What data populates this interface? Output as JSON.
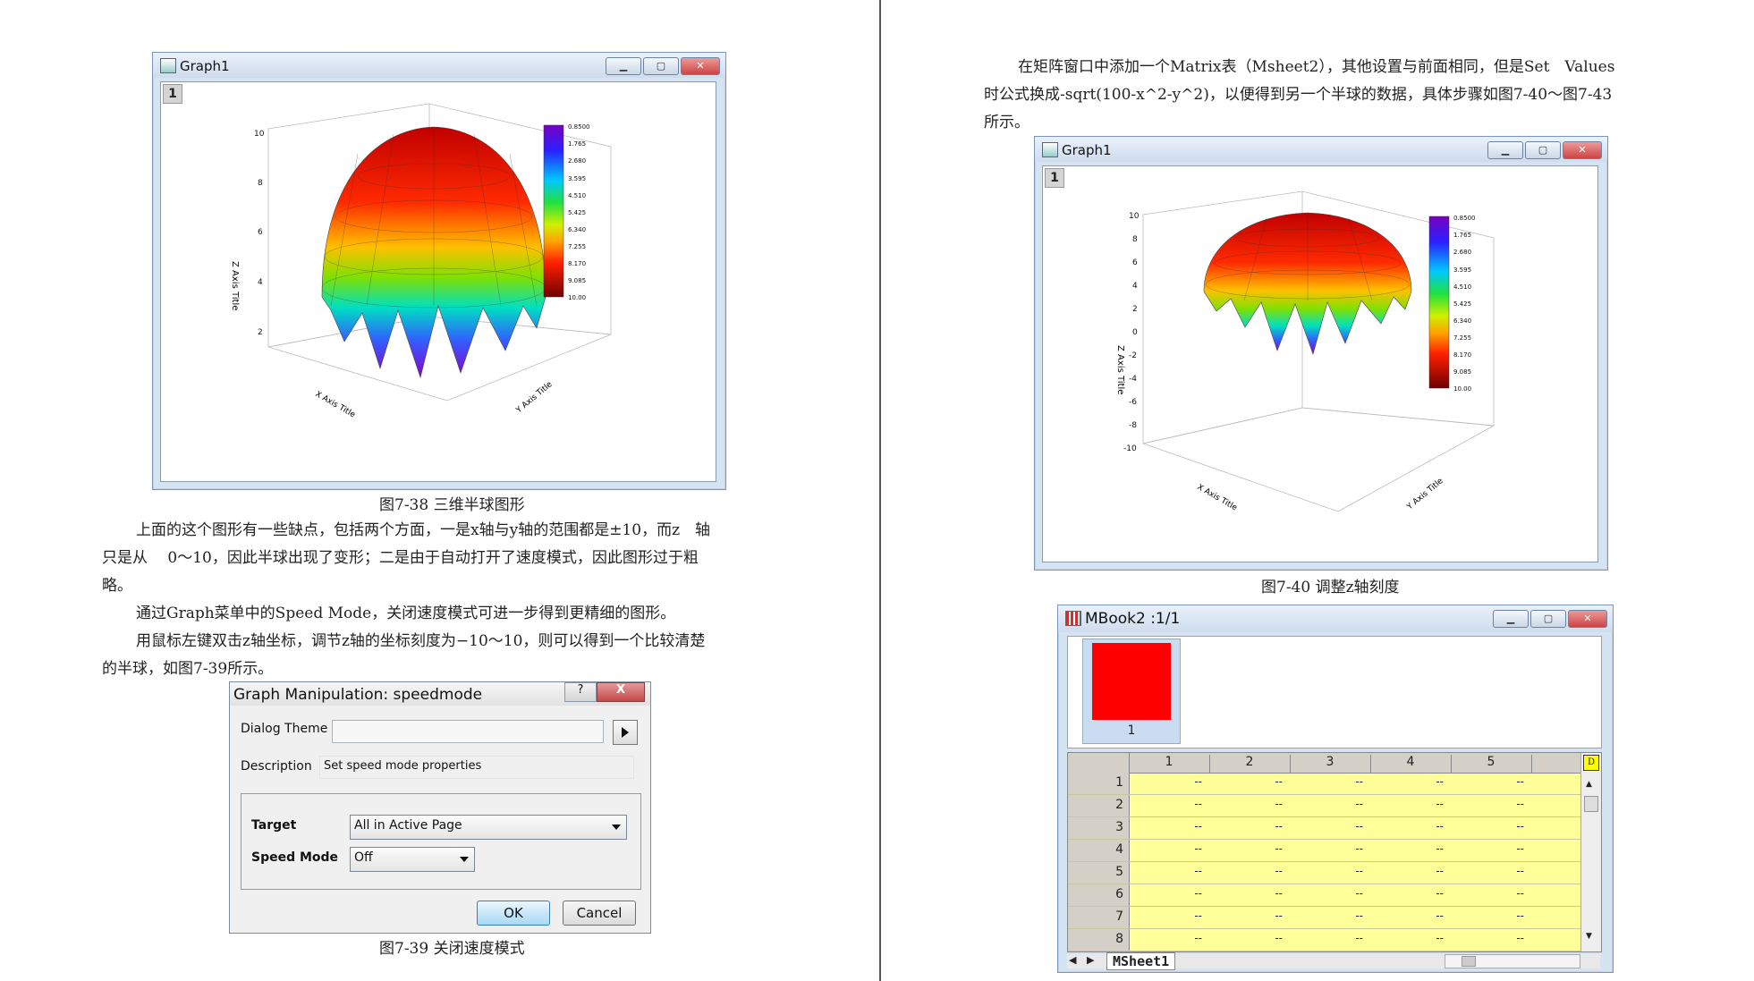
{
  "left": {
    "fig1": {
      "window_title": "Graph1",
      "layer": "1",
      "z_axis_title": "Z Axis Title",
      "x_axis_title": "X Axis Title",
      "y_axis_title": "Y Axis Title",
      "z_ticks": [
        "10",
        "8",
        "6",
        "4",
        "2"
      ],
      "colorbar": [
        "0.8500",
        "1.765",
        "2.680",
        "3.595",
        "4.510",
        "5.425",
        "6.340",
        "7.255",
        "8.170",
        "9.085",
        "10.00"
      ],
      "caption": "图7-38 三维半球图形"
    },
    "p1": "上面的这个图形有一些缺点，包括两个方面，一是x轴与y轴的范围都是±10，而z　轴",
    "p1b": "只是从　 0～10，因此半球出现了变形；二是由于自动打开了速度模式，因此图形过于粗",
    "p1c": "略。",
    "p2": "通过Graph菜单中的Speed Mode，关闭速度模式可进一步得到更精细的图形。",
    "p3": "用鼠标左键双击z轴坐标，调节z轴的坐标刻度为−10～10，则可以得到一个比较清楚",
    "p3b": "的半球，如图7-39所示。",
    "dialog": {
      "title": "Graph Manipulation: speedmode",
      "help_btn": "?",
      "close_btn": "X",
      "theme_label": "Dialog Theme",
      "theme_value": "",
      "desc_label": "Description",
      "desc_value": "Set speed mode properties",
      "target_label": "Target",
      "target_value": "All in Active Page",
      "speed_label": "Speed Mode",
      "speed_value": "Off",
      "ok": "OK",
      "cancel": "Cancel"
    },
    "cap2": "图7-39 关闭速度模式"
  },
  "right": {
    "p1": "在矩阵窗口中添加一个Matrix表（Msheet2），其他设置与前面相同，但是Set　Values",
    "p1b": "时公式换成-sqrt(100-x^2-y^2)，以便得到另一个半球的数据，具体步骤如图7-40～图7-43",
    "p1c": "所示。",
    "fig2": {
      "window_title": "Graph1",
      "layer": "1",
      "z_axis_title": "Z Axis Title",
      "x_axis_title": "X Axis Title",
      "y_axis_title": "Y Axis Title",
      "z_ticks": [
        "10",
        "8",
        "6",
        "4",
        "2",
        "0",
        "-2",
        "-4",
        "-6",
        "-8",
        "-10"
      ],
      "colorbar": [
        "0.8500",
        "1.765",
        "2.680",
        "3.595",
        "4.510",
        "5.425",
        "6.340",
        "7.255",
        "8.170",
        "9.085",
        "10.00"
      ],
      "caption": "图7-40 调整z轴刻度"
    },
    "mbook": {
      "title": "MBook2 :1/1",
      "thumb_label": "1",
      "columns": [
        "1",
        "2",
        "3",
        "4",
        "5"
      ],
      "rows": [
        "1",
        "2",
        "3",
        "4",
        "5",
        "6",
        "7",
        "8"
      ],
      "cell": "--",
      "sheet_tab": "MSheet1"
    }
  },
  "colors": {
    "red": "#ff0000",
    "cell_yellow": "#ffff99",
    "chrome": "#d6e3f2"
  }
}
